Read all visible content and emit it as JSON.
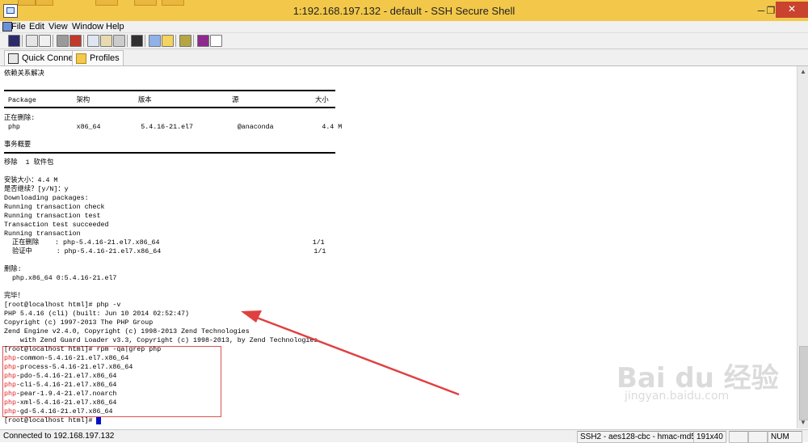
{
  "window": {
    "title": "1:192.168.197.132 - default - SSH Secure Shell",
    "minimize": "─",
    "maximize": "❐",
    "close": "✕"
  },
  "menu": [
    "File",
    "Edit",
    "View",
    "Window",
    "Help"
  ],
  "quickbar": {
    "quick_connect": "Quick Connect",
    "profiles": "Profiles"
  },
  "terminal": {
    "lines": [
      "依赖关系解决",
      "",
      "",
      " Package          架构            版本                    源                   大小",
      "",
      "正在删除:",
      " php              x86_64          5.4.16-21.el7           @anaconda            4.4 M",
      "",
      "事务概要",
      "",
      "移除  1 软件包",
      "",
      "安装大小：4.4 M",
      "是否继续？[y/N]：y",
      "Downloading packages:",
      "Running transaction check",
      "Running transaction test",
      "Transaction test succeeded",
      "Running transaction",
      "  正在删除    : php-5.4.16-21.el7.x86_64                                      1/1",
      "  验证中      : php-5.4.16-21.el7.x86_64                                      1/1",
      "",
      "删除:",
      "  php.x86_64 0:5.4.16-21.el7",
      "",
      "完毕！",
      "[root@localhost html]# php -v",
      "PHP 5.4.16 (cli) (built: Jun 10 2014 02:52:47)",
      "Copyright (c) 1997-2013 The PHP Group",
      "Zend Engine v2.4.0, Copyright (c) 1998-2013 Zend Technologies",
      "    with Zend Guard Loader v3.3, Copyright (c) 1998-2013, by Zend Technologies",
      "[root@localhost html]# rpm -qa|grep php"
    ],
    "rpm_results": [
      "-common-5.4.16-21.el7.x86_64",
      "-process-5.4.16-21.el7.x86_64",
      "-pdo-5.4.16-21.el7.x86_64",
      "-cli-5.4.16-21.el7.x86_64",
      "-pear-1.9.4-21.el7.noarch",
      "-xml-5.4.16-21.el7.x86_64",
      "-gd-5.4.16-21.el7.x86_64"
    ],
    "match_prefix": "php",
    "prompt": "[root@localhost html]# ",
    "highlight_color": "#e02020"
  },
  "watermark": {
    "big": "Bai du 经验",
    "small": "jingyan.baidu.com"
  },
  "status": {
    "connection": "Connected to 192.168.197.132",
    "protocol": "SSH2 - aes128-cbc - hmac-md5",
    "size": "191x40",
    "num": "NUM"
  },
  "colors": {
    "titlebar": "#f3c84a",
    "close": "#c9432f",
    "cursor": "#0010c8"
  }
}
